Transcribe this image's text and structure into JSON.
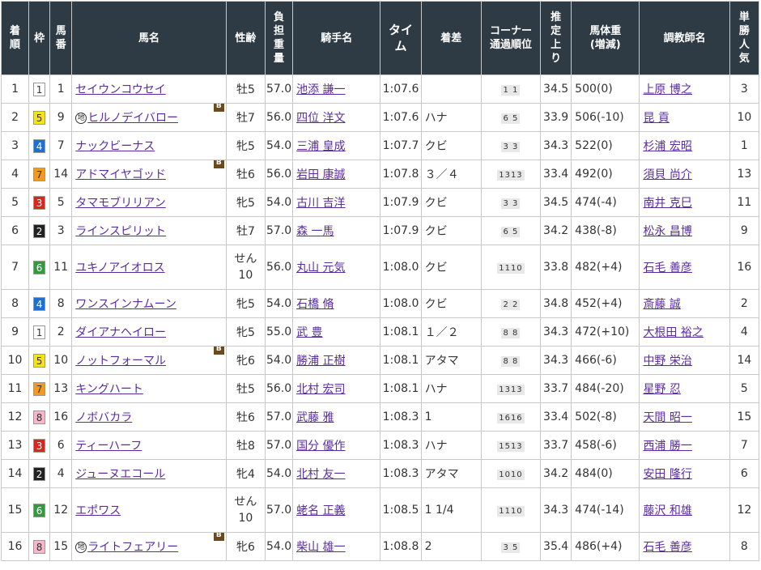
{
  "headers": {
    "rank": "着順",
    "waku": "枠",
    "umaban": "馬番",
    "horse": "馬名",
    "sexage": "性齢",
    "weight": "負担重量",
    "jockey": "騎手名",
    "time": "タイム",
    "margin": "着差",
    "corner": "コーナー通過順位",
    "last3f": "推定上り",
    "body": "馬体重(増減)",
    "trainer": "調教師名",
    "pop": "単勝人気"
  },
  "colors": {
    "header_bg": "#2e3a44",
    "link": "#5a2ca0",
    "blinker_badge": "#6b4a1e"
  },
  "icons": {
    "chi": "地",
    "blinker": "B"
  },
  "rows": [
    {
      "rank": "1",
      "waku": "1",
      "umaban": "1",
      "horse": "セイウンコウセイ",
      "chi": false,
      "blinker": false,
      "sexage": "牡5",
      "weight": "57.0",
      "jockey": "池添 謙一",
      "time": "1:07.6",
      "margin": "",
      "corner": "1 1",
      "last3f": "34.5",
      "body": "500(0)",
      "trainer": "上原 博之",
      "pop": "3"
    },
    {
      "rank": "2",
      "waku": "5",
      "umaban": "9",
      "horse": "ヒルノデイバロー",
      "chi": true,
      "blinker": true,
      "sexage": "牡7",
      "weight": "56.0",
      "jockey": "四位 洋文",
      "time": "1:07.6",
      "margin": "ハナ",
      "corner": "6 5",
      "last3f": "33.9",
      "body": "506(-10)",
      "trainer": "昆 貢",
      "pop": "10"
    },
    {
      "rank": "3",
      "waku": "4",
      "umaban": "7",
      "horse": "ナックビーナス",
      "chi": false,
      "blinker": false,
      "sexage": "牝5",
      "weight": "54.0",
      "jockey": "三浦 皇成",
      "time": "1:07.7",
      "margin": "クビ",
      "corner": "3 3",
      "last3f": "34.3",
      "body": "522(0)",
      "trainer": "杉浦 宏昭",
      "pop": "1"
    },
    {
      "rank": "4",
      "waku": "7",
      "umaban": "14",
      "horse": "アドマイヤゴッド",
      "chi": false,
      "blinker": true,
      "sexage": "牡6",
      "weight": "56.0",
      "jockey": "岩田 康誠",
      "time": "1:07.8",
      "margin": "３／４",
      "corner": "1313",
      "last3f": "33.4",
      "body": "492(0)",
      "trainer": "須貝 尚介",
      "pop": "13"
    },
    {
      "rank": "5",
      "waku": "3",
      "umaban": "5",
      "horse": "タマモブリリアン",
      "chi": false,
      "blinker": false,
      "sexage": "牝5",
      "weight": "54.0",
      "jockey": "古川 吉洋",
      "time": "1:07.9",
      "margin": "クビ",
      "corner": "3 3",
      "last3f": "34.5",
      "body": "474(-4)",
      "trainer": "南井 克巳",
      "pop": "11"
    },
    {
      "rank": "6",
      "waku": "2",
      "umaban": "3",
      "horse": "ラインスピリット",
      "chi": false,
      "blinker": false,
      "sexage": "牡7",
      "weight": "57.0",
      "jockey": "森 一馬",
      "time": "1:07.9",
      "margin": "クビ",
      "corner": "6 5",
      "last3f": "34.2",
      "body": "438(-8)",
      "trainer": "松永 昌博",
      "pop": "9"
    },
    {
      "rank": "7",
      "waku": "6",
      "umaban": "11",
      "horse": "ユキノアイオロス",
      "chi": false,
      "blinker": false,
      "sexage": "せん10",
      "sexage1": "せん",
      "sexage2": "10",
      "weight": "56.0",
      "jockey": "丸山 元気",
      "time": "1:08.0",
      "margin": "クビ",
      "corner": "1110",
      "last3f": "33.8",
      "body": "482(+4)",
      "trainer": "石毛 善彦",
      "pop": "16"
    },
    {
      "rank": "8",
      "waku": "4",
      "umaban": "8",
      "horse": "ワンスインナムーン",
      "chi": false,
      "blinker": false,
      "sexage": "牝5",
      "weight": "54.0",
      "jockey": "石橋 脩",
      "time": "1:08.0",
      "margin": "クビ",
      "corner": "2 2",
      "last3f": "34.8",
      "body": "452(+4)",
      "trainer": "斎藤 誠",
      "pop": "2"
    },
    {
      "rank": "9",
      "waku": "1",
      "umaban": "2",
      "horse": "ダイアナヘイロー",
      "chi": false,
      "blinker": false,
      "sexage": "牝5",
      "weight": "55.0",
      "jockey": "武 豊",
      "time": "1:08.1",
      "margin": "１／２",
      "corner": "8 8",
      "last3f": "34.3",
      "body": "472(+10)",
      "trainer": "大根田 裕之",
      "pop": "4"
    },
    {
      "rank": "10",
      "waku": "5",
      "umaban": "10",
      "horse": "ノットフォーマル",
      "chi": false,
      "blinker": true,
      "sexage": "牝6",
      "weight": "54.0",
      "jockey": "勝浦 正樹",
      "time": "1:08.1",
      "margin": "アタマ",
      "corner": "8 8",
      "last3f": "34.3",
      "body": "466(-6)",
      "trainer": "中野 栄治",
      "pop": "14"
    },
    {
      "rank": "11",
      "waku": "7",
      "umaban": "13",
      "horse": "キングハート",
      "chi": false,
      "blinker": false,
      "sexage": "牡5",
      "weight": "56.0",
      "jockey": "北村 宏司",
      "time": "1:08.1",
      "margin": "ハナ",
      "corner": "1313",
      "last3f": "33.7",
      "body": "484(-20)",
      "trainer": "星野 忍",
      "pop": "5"
    },
    {
      "rank": "12",
      "waku": "8",
      "umaban": "16",
      "horse": "ノボバカラ",
      "chi": false,
      "blinker": false,
      "sexage": "牡6",
      "weight": "57.0",
      "jockey": "武藤 雅",
      "time": "1:08.3",
      "margin": "1",
      "corner": "1616",
      "last3f": "33.4",
      "body": "502(-8)",
      "trainer": "天間 昭一",
      "pop": "15"
    },
    {
      "rank": "13",
      "waku": "3",
      "umaban": "6",
      "horse": "ティーハーフ",
      "chi": false,
      "blinker": false,
      "sexage": "牡8",
      "weight": "57.0",
      "jockey": "国分 優作",
      "time": "1:08.3",
      "margin": "ハナ",
      "corner": "1513",
      "last3f": "33.7",
      "body": "458(-6)",
      "trainer": "西浦 勝一",
      "pop": "7"
    },
    {
      "rank": "14",
      "waku": "2",
      "umaban": "4",
      "horse": "ジューヌエコール",
      "chi": false,
      "blinker": false,
      "sexage": "牝4",
      "weight": "54.0",
      "jockey": "北村 友一",
      "time": "1:08.3",
      "margin": "アタマ",
      "corner": "1010",
      "last3f": "34.2",
      "body": "484(0)",
      "trainer": "安田 隆行",
      "pop": "6"
    },
    {
      "rank": "15",
      "waku": "6",
      "umaban": "12",
      "horse": "エポワス",
      "chi": false,
      "blinker": false,
      "sexage": "せん10",
      "sexage1": "せん",
      "sexage2": "10",
      "weight": "57.0",
      "jockey": "蛯名 正義",
      "time": "1:08.5",
      "margin": "1 1/4",
      "corner": "1110",
      "last3f": "34.3",
      "body": "474(-14)",
      "trainer": "藤沢 和雄",
      "pop": "12"
    },
    {
      "rank": "16",
      "waku": "8",
      "umaban": "15",
      "horse": "ライトフェアリー",
      "chi": true,
      "blinker": true,
      "sexage": "牝6",
      "weight": "54.0",
      "jockey": "柴山 雄一",
      "time": "1:08.8",
      "margin": "2",
      "corner": "3 5",
      "last3f": "35.4",
      "body": "486(+4)",
      "trainer": "石毛 善彦",
      "pop": "8"
    }
  ]
}
